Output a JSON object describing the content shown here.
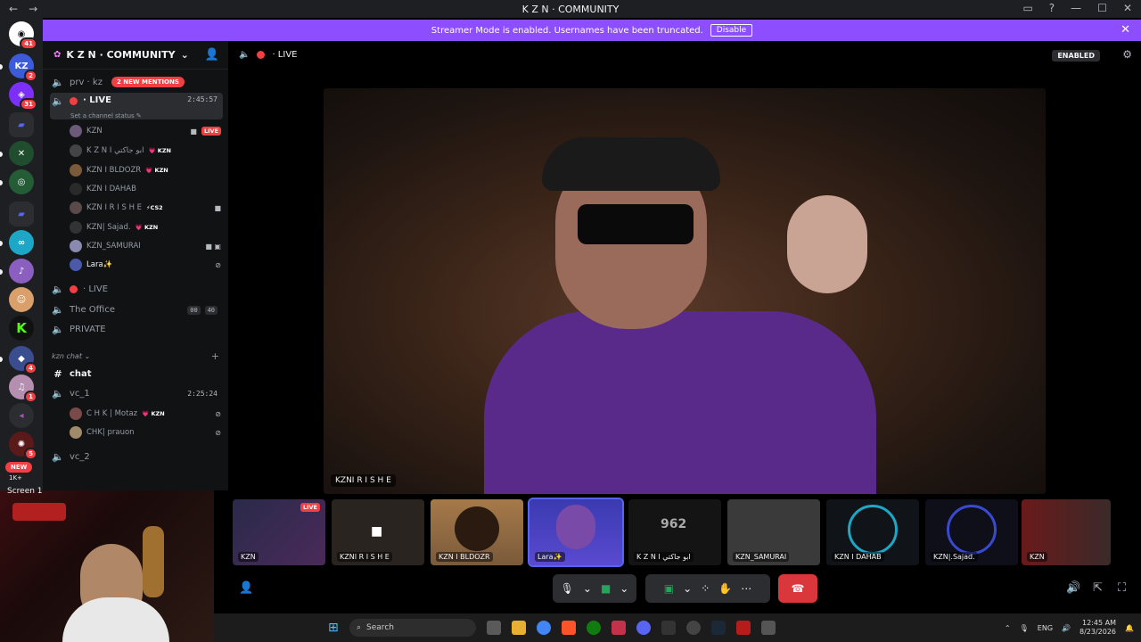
{
  "window": {
    "title": "K Z N · COMMUNITY",
    "back": "←",
    "forward": "→",
    "controls": [
      "▭",
      "?",
      "—",
      "☐",
      "✕"
    ]
  },
  "rail": {
    "badges": [
      "41",
      "2",
      "31",
      "4",
      "1",
      "5",
      "1K+"
    ],
    "new_label": "NEW"
  },
  "banner": {
    "text": "Streamer Mode is enabled. Usernames have been truncated.",
    "disable": "Disable",
    "close": "✕"
  },
  "guild": {
    "name": "K Z N · COMMUNITY",
    "chevron": "⌄"
  },
  "channels": {
    "prv": "prv · kz",
    "mentions": "2 NEW MENTIONS",
    "live1": "· LIVE",
    "live1_time": "2:45:57",
    "live1_status": "Set a channel status ✎",
    "live2": "· LIVE",
    "office": "The Office",
    "office_a": "00",
    "office_b": "40",
    "private": "PRIVATE",
    "category": "kzn chat ⌄",
    "chat": "chat",
    "vc1": "vc_1",
    "vc1_time": "2:25:24",
    "vc2": "vc_2",
    "screen": "Screen 1"
  },
  "users_live": [
    {
      "name": "KZN",
      "tag": "",
      "live": "LIVE"
    },
    {
      "name": "K Z N I ابو جاكتي",
      "tag": "💗 KZN",
      "live": ""
    },
    {
      "name": "KZN I BLDOZR",
      "tag": "💗 KZN",
      "live": ""
    },
    {
      "name": "KZN I DAHAB",
      "tag": "",
      "live": ""
    },
    {
      "name": "KZN I R I S H E",
      "tag": "⚡CS2",
      "live": ""
    },
    {
      "name": "KZN| Sajad.",
      "tag": "💗 KZN",
      "live": ""
    },
    {
      "name": "KZN_SAMURAI",
      "tag": "",
      "live": ""
    },
    {
      "name": "Lara✨",
      "tag": "",
      "live": ""
    }
  ],
  "users_vc1": [
    {
      "name": "C H K | Motaz",
      "tag": "💗 KZN"
    },
    {
      "name": "CHK| prauon",
      "tag": ""
    }
  ],
  "main": {
    "channel": "· LIVE",
    "enabled": "ENABLED",
    "stage_name": "KZNI R I S H E"
  },
  "tiles": [
    {
      "name": "KZN",
      "live": "LIVE"
    },
    {
      "name": "KZNI R I S H E",
      "live": ""
    },
    {
      "name": "KZN I BLDOZR",
      "live": ""
    },
    {
      "name": "Lara✨",
      "live": ""
    },
    {
      "name": "K Z N I ابو جاكتي",
      "live": ""
    },
    {
      "name": "KZN_SAMURAI",
      "live": ""
    },
    {
      "name": "KZN I DAHAB",
      "live": ""
    },
    {
      "name": "KZN|.Sajad.",
      "live": ""
    },
    {
      "name": "KZN",
      "live": ""
    }
  ],
  "controls": {
    "mic": "🎙",
    "cam": "■",
    "share": "▣",
    "activities": "⁘",
    "soundboard": "✋",
    "more": "⋯",
    "hangup": "☎",
    "volume": "🔊",
    "popout": "⇱",
    "fullscreen": "⛶"
  },
  "taskbar": {
    "search": "Search",
    "lang": "ENG",
    "time": "12:45 AM",
    "date": "8/23/2026"
  }
}
